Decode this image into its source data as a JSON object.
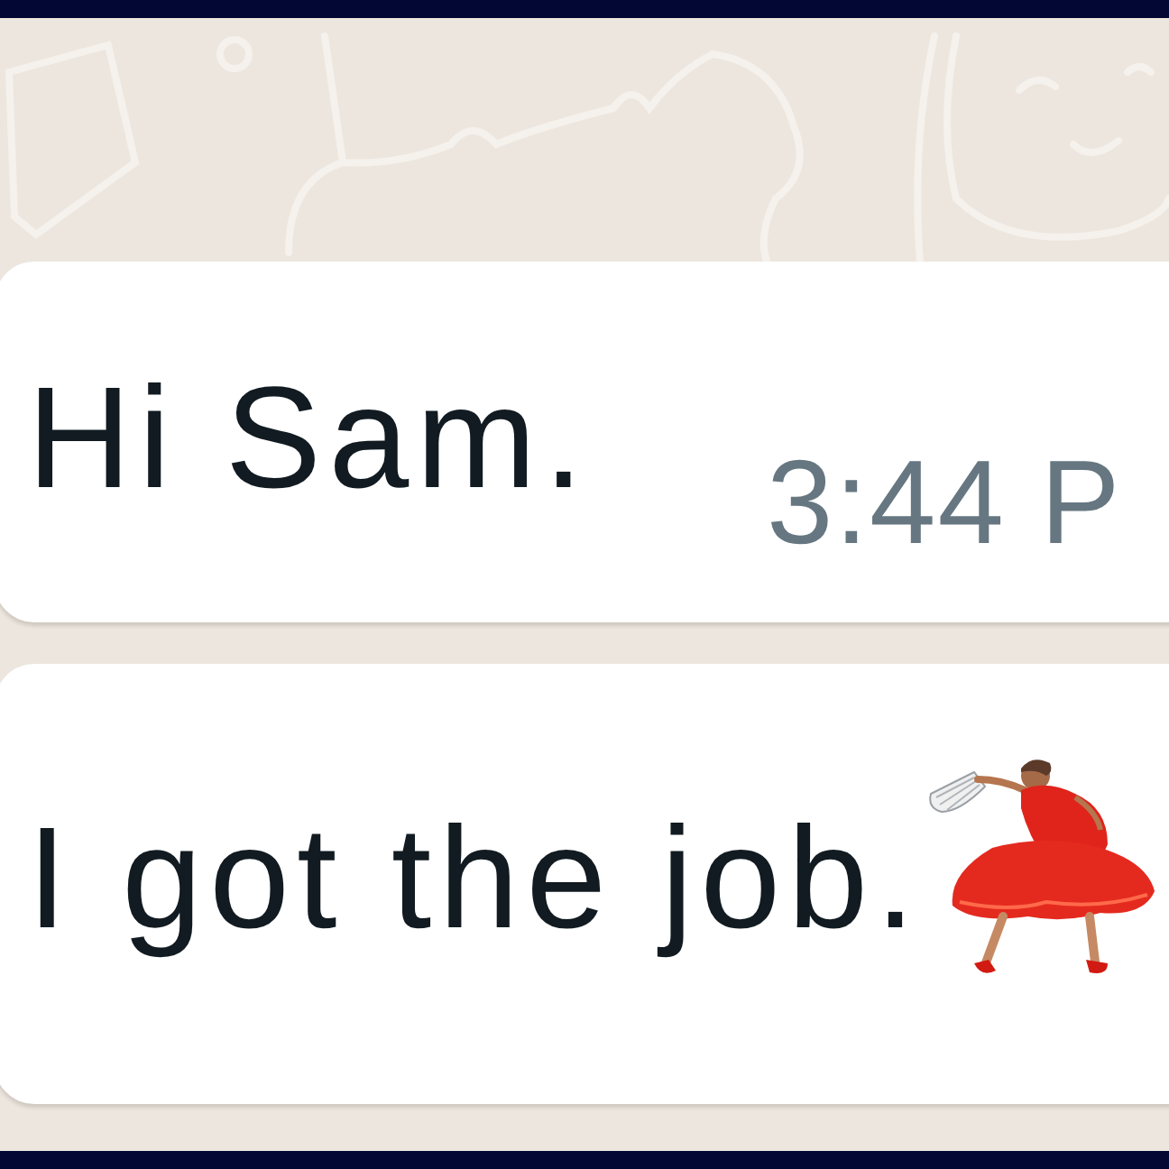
{
  "messages": [
    {
      "text": "Hi Sam.",
      "time": "3:44 P",
      "emoji": false
    },
    {
      "text": "I got the job.",
      "emoji": true
    }
  ]
}
